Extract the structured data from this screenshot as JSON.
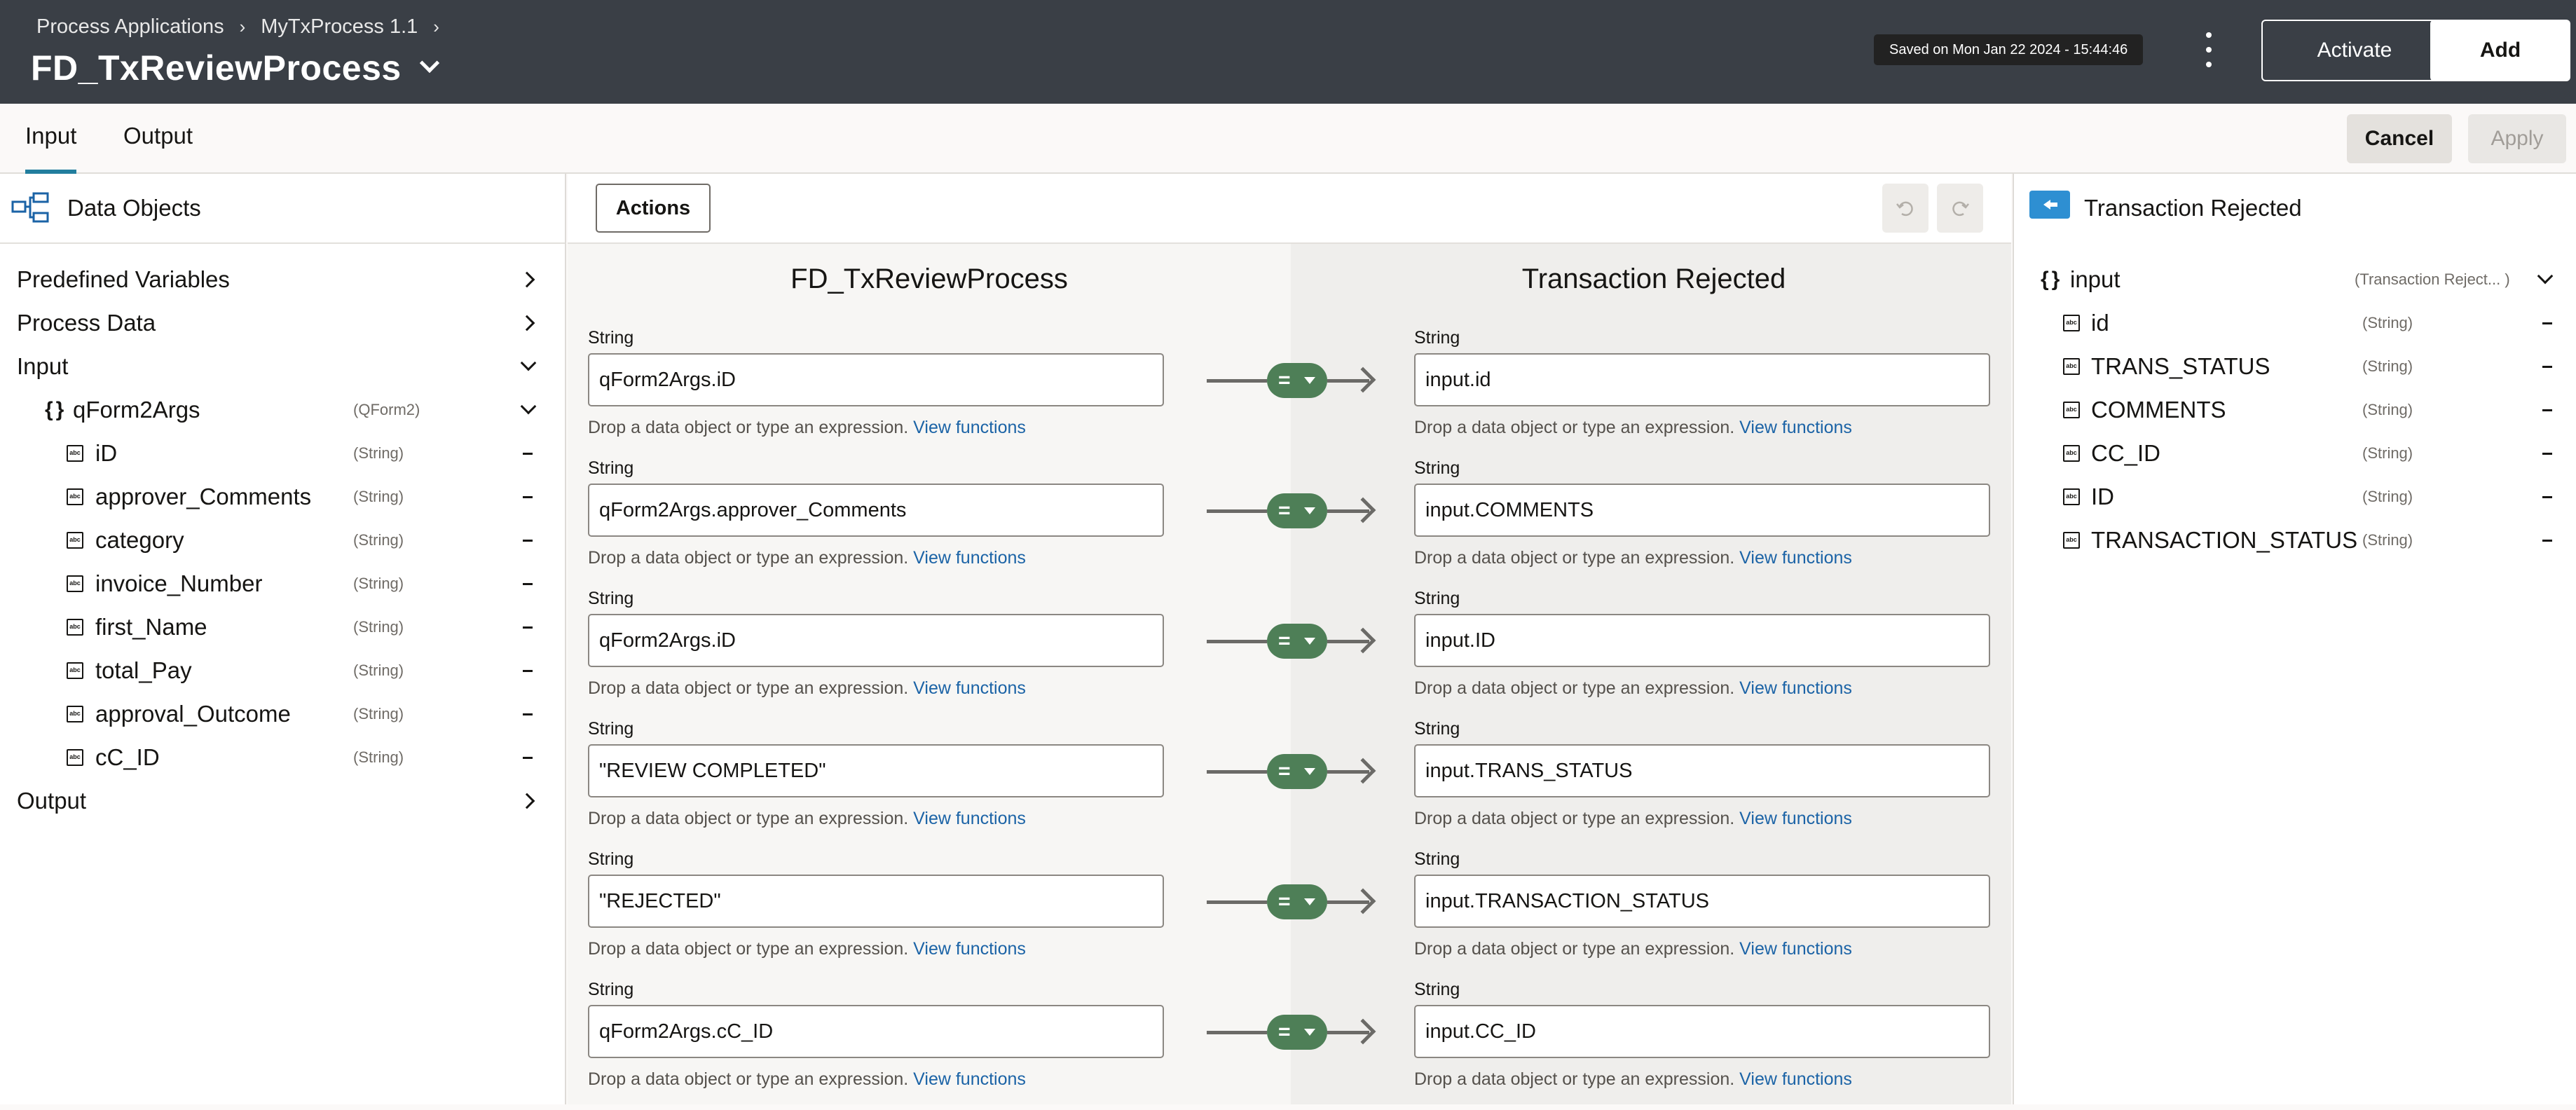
{
  "header": {
    "breadcrumb": [
      "Process Applications",
      "MyTxProcess 1.1"
    ],
    "title": "FD_TxReviewProcess",
    "saved_status": "Saved on Mon Jan 22 2024 - 15:44:46",
    "activate_label": "Activate",
    "add_label": "Add"
  },
  "tabs": [
    {
      "label": "Input",
      "active": true
    },
    {
      "label": "Output",
      "active": false
    }
  ],
  "toolbar": {
    "cancel_label": "Cancel",
    "apply_label": "Apply",
    "actions_label": "Actions"
  },
  "left_panel": {
    "title": "Data Objects",
    "items": [
      {
        "label": "Predefined Variables"
      },
      {
        "label": "Process Data"
      },
      {
        "label": "Input"
      },
      {
        "label": "qForm2Args",
        "type": "(QForm2)"
      },
      {
        "label": "iD",
        "type": "(String)"
      },
      {
        "label": "approver_Comments",
        "type": "(String)"
      },
      {
        "label": "category",
        "type": "(String)"
      },
      {
        "label": "invoice_Number",
        "type": "(String)"
      },
      {
        "label": "first_Name",
        "type": "(String)"
      },
      {
        "label": "total_Pay",
        "type": "(String)"
      },
      {
        "label": "approval_Outcome",
        "type": "(String)"
      },
      {
        "label": "cC_ID",
        "type": "(String)"
      },
      {
        "label": "Output"
      }
    ]
  },
  "mapper": {
    "source_title": "FD_TxReviewProcess",
    "target_title": "Transaction Rejected",
    "operator": "=",
    "hint": "Drop a data object or type an expression.",
    "hint_link": "View functions",
    "rows": [
      {
        "src_type": "String",
        "src": "qForm2Args.iD",
        "tgt_type": "String",
        "tgt": "input.id"
      },
      {
        "src_type": "String",
        "src": "qForm2Args.approver_Comments",
        "tgt_type": "String",
        "tgt": "input.COMMENTS"
      },
      {
        "src_type": "String",
        "src": "qForm2Args.iD",
        "tgt_type": "String",
        "tgt": "input.ID"
      },
      {
        "src_type": "String",
        "src": "\"REVIEW COMPLETED\"",
        "tgt_type": "String",
        "tgt": "input.TRANS_STATUS"
      },
      {
        "src_type": "String",
        "src": "\"REJECTED\"",
        "tgt_type": "String",
        "tgt": "input.TRANSACTION_STATUS"
      },
      {
        "src_type": "String",
        "src": "qForm2Args.cC_ID",
        "tgt_type": "String",
        "tgt": "input.CC_ID"
      }
    ]
  },
  "right_panel": {
    "title": "Transaction Rejected",
    "root": {
      "label": "input",
      "type": "(Transaction Reject... )"
    },
    "items": [
      {
        "label": "id",
        "type": "(String)"
      },
      {
        "label": "TRANS_STATUS",
        "type": "(String)"
      },
      {
        "label": "COMMENTS",
        "type": "(String)"
      },
      {
        "label": "CC_ID",
        "type": "(String)"
      },
      {
        "label": "ID",
        "type": "(String)"
      },
      {
        "label": "TRANSACTION_STATUS",
        "type": "(String)"
      }
    ]
  },
  "colors": {
    "header_bg": "#3a3f46",
    "accent": "#227e9e",
    "operator_pill": "#4e7f57",
    "link": "#1b63a6"
  }
}
